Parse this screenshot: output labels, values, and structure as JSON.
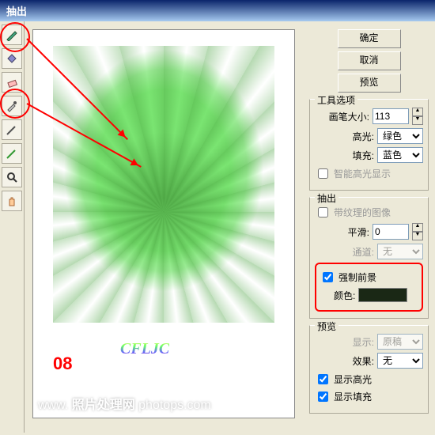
{
  "title": "抽出",
  "buttons": {
    "ok": "确定",
    "cancel": "取消",
    "preview": "预览"
  },
  "toolopt": {
    "title": "工具选项",
    "brush": "画笔大小:",
    "brushval": "113",
    "hl": "高光:",
    "hlval": "绿色",
    "fill": "填充:",
    "fillval": "蓝色",
    "smart": "智能高光显示"
  },
  "extract": {
    "title": "抽出",
    "tex": "带纹理的图像",
    "smooth": "平滑:",
    "smoothval": "0",
    "chan": "通道:",
    "chanval": "无",
    "force": "强制前景",
    "color": "颜色:"
  },
  "prev": {
    "title": "预览",
    "show": "显示:",
    "showval": "原稿",
    "fx": "效果:",
    "fxval": "无",
    "shhl": "显示高光",
    "shfill": "显示填充"
  },
  "step": "08",
  "logo": "CFLJC",
  "wm1": "www.",
  "wm2": "照片处理网",
  "wm3": "photops.com"
}
